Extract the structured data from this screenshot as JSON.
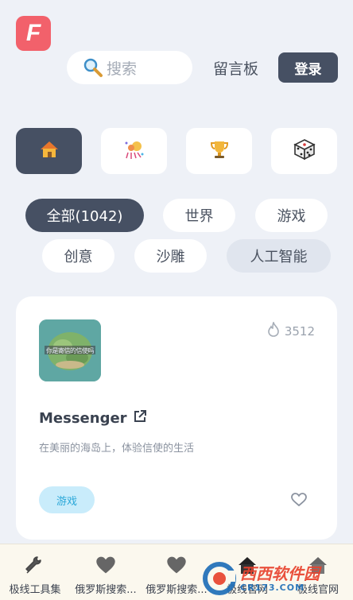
{
  "header": {
    "logo_letter": "F",
    "search_placeholder": "搜索",
    "message_board": "留言板",
    "login": "登录"
  },
  "category_tiles": [
    {
      "icon": "house-icon",
      "active": true
    },
    {
      "icon": "fireworks-icon",
      "active": false
    },
    {
      "icon": "trophy-icon",
      "active": false
    },
    {
      "icon": "dice-icon",
      "active": false
    }
  ],
  "filters": {
    "all": "全部(1042)",
    "world": "世界",
    "game": "游戏",
    "creative": "创意",
    "sculpture": "沙雕",
    "ai": "人工智能"
  },
  "card": {
    "hot_count": "3512",
    "title": "Messenger",
    "description": "在美丽的海岛上，体验信使的生活",
    "tag": "游戏",
    "thumb_text": "你是寄信的信使吗"
  },
  "bottom_nav": [
    {
      "label": "极线工具集",
      "icon": "wrench-icon"
    },
    {
      "label": "俄罗斯搜索...",
      "icon": "heart-icon"
    },
    {
      "label": "俄罗斯搜索...",
      "icon": "heart-icon"
    },
    {
      "label": "极线官网",
      "icon": "house-icon"
    },
    {
      "label": "极线官网",
      "icon": "house-icon"
    }
  ],
  "watermark": {
    "main": "西西软件园",
    "sub": "CR173.COM"
  },
  "colors": {
    "background": "#eef1f7",
    "dark": "#465063",
    "logo": "#f2616b",
    "tag_bg": "#c9ecfb",
    "tag_text": "#2aa7d8"
  }
}
